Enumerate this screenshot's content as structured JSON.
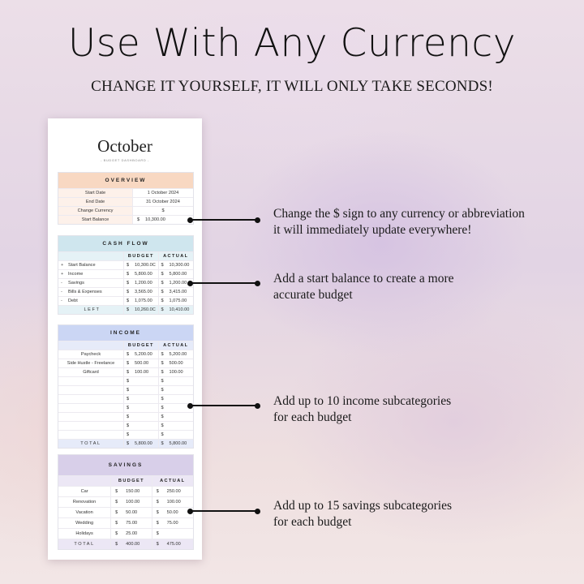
{
  "header": {
    "title": "Use With Any Currency",
    "subtitle": "CHANGE IT YOURSELF, IT WILL ONLY TAKE SECONDS!"
  },
  "sheet": {
    "month": "October",
    "subtitle": "- BUDGET DASHBOARD -",
    "currency_symbol": "$",
    "overview": {
      "title": "OVERVIEW",
      "rows": [
        {
          "label": "Start Date",
          "value": "1 October 2024"
        },
        {
          "label": "End Date",
          "value": "31 October 2024"
        },
        {
          "label": "Change Currency",
          "value": "$"
        },
        {
          "label": "Start Balance",
          "value": "10,300.00"
        }
      ]
    },
    "cash_flow": {
      "title": "CASH FLOW",
      "col_budget": "BUDGET",
      "col_actual": "ACTUAL",
      "rows": [
        {
          "sign": "+",
          "label": "Start Balance",
          "budget": "10,300.0C",
          "actual": "10,300.00"
        },
        {
          "sign": "+",
          "label": "Income",
          "budget": "5,800.00",
          "actual": "5,800.00"
        },
        {
          "sign": "-",
          "label": "Savings",
          "budget": "1,200.00",
          "actual": "1,200.00"
        },
        {
          "sign": "-",
          "label": "Bills & Expenses",
          "budget": "3,565.00",
          "actual": "3,415.00"
        },
        {
          "sign": "-",
          "label": "Debt",
          "budget": "1,075.00",
          "actual": "1,075.00"
        }
      ],
      "total_label": "LEFT",
      "total_budget": "10,260.0C",
      "total_actual": "10,410.00"
    },
    "income": {
      "title": "INCOME",
      "col_budget": "BUDGET",
      "col_actual": "ACTUAL",
      "rows": [
        {
          "label": "Paycheck",
          "budget": "5,200.00",
          "actual": "5,200.00"
        },
        {
          "label": "Side Hustle - Freelance",
          "budget": "500.00",
          "actual": "500.00"
        },
        {
          "label": "Giftcard",
          "budget": "100.00",
          "actual": "100.00"
        },
        {
          "label": "",
          "budget": "",
          "actual": ""
        },
        {
          "label": "",
          "budget": "",
          "actual": ""
        },
        {
          "label": "",
          "budget": "",
          "actual": ""
        },
        {
          "label": "",
          "budget": "",
          "actual": ""
        },
        {
          "label": "",
          "budget": "",
          "actual": ""
        },
        {
          "label": "",
          "budget": "",
          "actual": ""
        },
        {
          "label": "",
          "budget": "",
          "actual": ""
        }
      ],
      "total_label": "TOTAL",
      "total_budget": "5,800.00",
      "total_actual": "5,800.00"
    },
    "savings": {
      "title": "SAVINGS",
      "col_budget": "BUDGET",
      "col_actual": "ACTUAL",
      "rows": [
        {
          "label": "Car",
          "budget": "150.00",
          "actual": "250.00"
        },
        {
          "label": "Renovation",
          "budget": "100.00",
          "actual": "100.00"
        },
        {
          "label": "Vacation",
          "budget": "50.00",
          "actual": "50.00"
        },
        {
          "label": "Wedding",
          "budget": "75.00",
          "actual": "75.00"
        },
        {
          "label": "Holidays",
          "budget": "25.00",
          "actual": ""
        }
      ],
      "total_label": "TOTAL",
      "total_budget": "400.00",
      "total_actual": "475.00"
    }
  },
  "annotations": [
    {
      "line1": "Change the $ sign to any currency or abbreviation",
      "line2": "it will immediately update everywhere!"
    },
    {
      "line1": "Add a start balance to create a more",
      "line2": "accurate budget"
    },
    {
      "line1": "Add up to 10 income subcategories",
      "line2": "for each budget"
    },
    {
      "line1": "Add up to 15 savings subcategories",
      "line2": "for each budget"
    }
  ]
}
